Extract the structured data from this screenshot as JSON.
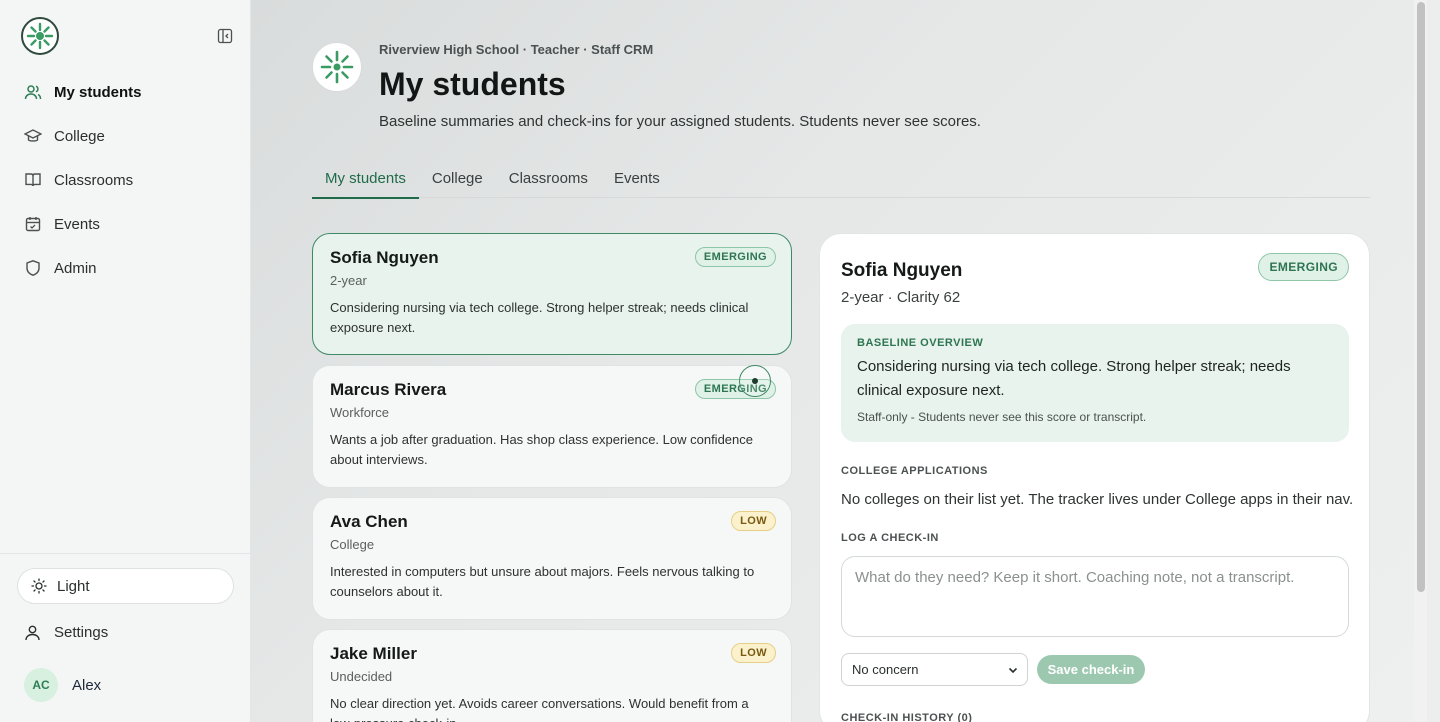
{
  "sidebar": {
    "items": [
      {
        "label": "My students",
        "icon": "users-icon",
        "active": true
      },
      {
        "label": "College",
        "icon": "graduation-cap-icon"
      },
      {
        "label": "Classrooms",
        "icon": "book-icon"
      },
      {
        "label": "Events",
        "icon": "calendar-icon"
      },
      {
        "label": "Admin",
        "icon": "shield-icon"
      }
    ],
    "theme_label": "Light",
    "settings_label": "Settings",
    "user": {
      "initials": "AC",
      "name": "Alex"
    }
  },
  "header": {
    "breadcrumb": "Riverview High School · Teacher · Staff CRM",
    "title": "My students",
    "subtitle": "Baseline summaries and check-ins for your assigned students. Students never see scores."
  },
  "tabs": [
    {
      "label": "My students",
      "active": true
    },
    {
      "label": "College"
    },
    {
      "label": "Classrooms"
    },
    {
      "label": "Events"
    }
  ],
  "students": [
    {
      "name": "Sofia Nguyen",
      "track": "2-year",
      "badge": "EMERGING",
      "description": "Considering nursing via tech college. Strong helper streak; needs clinical exposure next."
    },
    {
      "name": "Marcus Rivera",
      "track": "Workforce",
      "badge": "EMERGING",
      "description": "Wants a job after graduation. Has shop class experience. Low confidence about interviews."
    },
    {
      "name": "Ava Chen",
      "track": "College",
      "badge": "LOW",
      "description": "Interested in computers but unsure about majors. Feels nervous talking to counselors about it."
    },
    {
      "name": "Jake Miller",
      "track": "Undecided",
      "badge": "LOW",
      "description": "No clear direction yet. Avoids career conversations. Would benefit from a low-pressure check-in."
    }
  ],
  "detail": {
    "name": "Sofia Nguyen",
    "meta": "2-year · Clarity 62",
    "badge": "EMERGING",
    "overview_label": "BASELINE OVERVIEW",
    "overview_text": "Considering nursing via tech college. Strong helper streak; needs clinical exposure next.",
    "overview_note": "Staff-only - Students never see this score or transcript.",
    "apps_label": "COLLEGE APPLICATIONS",
    "apps_text": "No colleges on their list yet. The tracker lives under College apps in their nav.",
    "checkin_label": "LOG A CHECK-IN",
    "checkin_placeholder": "What do they need? Keep it short. Coaching note, not a transcript.",
    "concern_value": "No concern",
    "save_label": "Save check-in",
    "history_label": "CHECK-IN HISTORY (0)"
  },
  "colors": {
    "accent": "#1f6b4a",
    "emerging_bg": "#e0f1e8",
    "low_bg": "#fbf1cc"
  }
}
